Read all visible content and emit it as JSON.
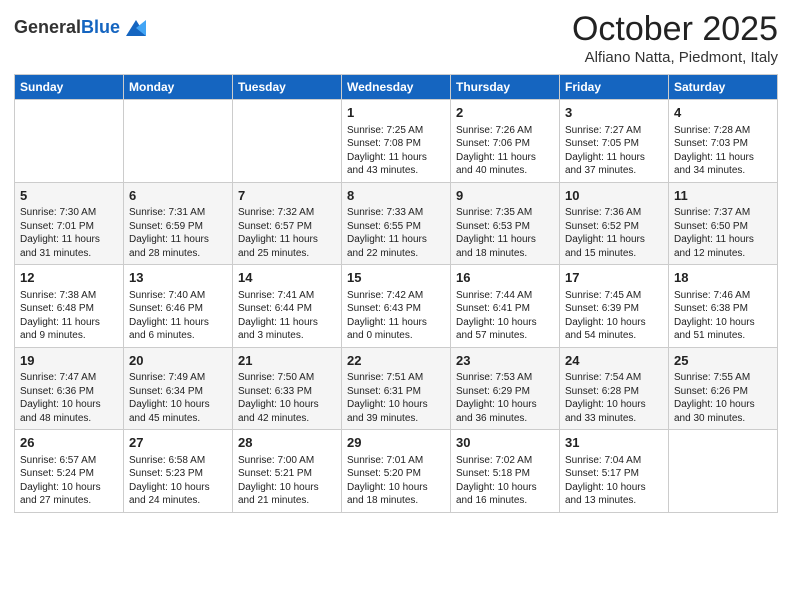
{
  "header": {
    "logo_general": "General",
    "logo_blue": "Blue",
    "month_title": "October 2025",
    "location": "Alfiano Natta, Piedmont, Italy"
  },
  "days_of_week": [
    "Sunday",
    "Monday",
    "Tuesday",
    "Wednesday",
    "Thursday",
    "Friday",
    "Saturday"
  ],
  "weeks": [
    [
      {
        "day": "",
        "content": ""
      },
      {
        "day": "",
        "content": ""
      },
      {
        "day": "",
        "content": ""
      },
      {
        "day": "1",
        "content": "Sunrise: 7:25 AM\nSunset: 7:08 PM\nDaylight: 11 hours\nand 43 minutes."
      },
      {
        "day": "2",
        "content": "Sunrise: 7:26 AM\nSunset: 7:06 PM\nDaylight: 11 hours\nand 40 minutes."
      },
      {
        "day": "3",
        "content": "Sunrise: 7:27 AM\nSunset: 7:05 PM\nDaylight: 11 hours\nand 37 minutes."
      },
      {
        "day": "4",
        "content": "Sunrise: 7:28 AM\nSunset: 7:03 PM\nDaylight: 11 hours\nand 34 minutes."
      }
    ],
    [
      {
        "day": "5",
        "content": "Sunrise: 7:30 AM\nSunset: 7:01 PM\nDaylight: 11 hours\nand 31 minutes."
      },
      {
        "day": "6",
        "content": "Sunrise: 7:31 AM\nSunset: 6:59 PM\nDaylight: 11 hours\nand 28 minutes."
      },
      {
        "day": "7",
        "content": "Sunrise: 7:32 AM\nSunset: 6:57 PM\nDaylight: 11 hours\nand 25 minutes."
      },
      {
        "day": "8",
        "content": "Sunrise: 7:33 AM\nSunset: 6:55 PM\nDaylight: 11 hours\nand 22 minutes."
      },
      {
        "day": "9",
        "content": "Sunrise: 7:35 AM\nSunset: 6:53 PM\nDaylight: 11 hours\nand 18 minutes."
      },
      {
        "day": "10",
        "content": "Sunrise: 7:36 AM\nSunset: 6:52 PM\nDaylight: 11 hours\nand 15 minutes."
      },
      {
        "day": "11",
        "content": "Sunrise: 7:37 AM\nSunset: 6:50 PM\nDaylight: 11 hours\nand 12 minutes."
      }
    ],
    [
      {
        "day": "12",
        "content": "Sunrise: 7:38 AM\nSunset: 6:48 PM\nDaylight: 11 hours\nand 9 minutes."
      },
      {
        "day": "13",
        "content": "Sunrise: 7:40 AM\nSunset: 6:46 PM\nDaylight: 11 hours\nand 6 minutes."
      },
      {
        "day": "14",
        "content": "Sunrise: 7:41 AM\nSunset: 6:44 PM\nDaylight: 11 hours\nand 3 minutes."
      },
      {
        "day": "15",
        "content": "Sunrise: 7:42 AM\nSunset: 6:43 PM\nDaylight: 11 hours\nand 0 minutes."
      },
      {
        "day": "16",
        "content": "Sunrise: 7:44 AM\nSunset: 6:41 PM\nDaylight: 10 hours\nand 57 minutes."
      },
      {
        "day": "17",
        "content": "Sunrise: 7:45 AM\nSunset: 6:39 PM\nDaylight: 10 hours\nand 54 minutes."
      },
      {
        "day": "18",
        "content": "Sunrise: 7:46 AM\nSunset: 6:38 PM\nDaylight: 10 hours\nand 51 minutes."
      }
    ],
    [
      {
        "day": "19",
        "content": "Sunrise: 7:47 AM\nSunset: 6:36 PM\nDaylight: 10 hours\nand 48 minutes."
      },
      {
        "day": "20",
        "content": "Sunrise: 7:49 AM\nSunset: 6:34 PM\nDaylight: 10 hours\nand 45 minutes."
      },
      {
        "day": "21",
        "content": "Sunrise: 7:50 AM\nSunset: 6:33 PM\nDaylight: 10 hours\nand 42 minutes."
      },
      {
        "day": "22",
        "content": "Sunrise: 7:51 AM\nSunset: 6:31 PM\nDaylight: 10 hours\nand 39 minutes."
      },
      {
        "day": "23",
        "content": "Sunrise: 7:53 AM\nSunset: 6:29 PM\nDaylight: 10 hours\nand 36 minutes."
      },
      {
        "day": "24",
        "content": "Sunrise: 7:54 AM\nSunset: 6:28 PM\nDaylight: 10 hours\nand 33 minutes."
      },
      {
        "day": "25",
        "content": "Sunrise: 7:55 AM\nSunset: 6:26 PM\nDaylight: 10 hours\nand 30 minutes."
      }
    ],
    [
      {
        "day": "26",
        "content": "Sunrise: 6:57 AM\nSunset: 5:24 PM\nDaylight: 10 hours\nand 27 minutes."
      },
      {
        "day": "27",
        "content": "Sunrise: 6:58 AM\nSunset: 5:23 PM\nDaylight: 10 hours\nand 24 minutes."
      },
      {
        "day": "28",
        "content": "Sunrise: 7:00 AM\nSunset: 5:21 PM\nDaylight: 10 hours\nand 21 minutes."
      },
      {
        "day": "29",
        "content": "Sunrise: 7:01 AM\nSunset: 5:20 PM\nDaylight: 10 hours\nand 18 minutes."
      },
      {
        "day": "30",
        "content": "Sunrise: 7:02 AM\nSunset: 5:18 PM\nDaylight: 10 hours\nand 16 minutes."
      },
      {
        "day": "31",
        "content": "Sunrise: 7:04 AM\nSunset: 5:17 PM\nDaylight: 10 hours\nand 13 minutes."
      },
      {
        "day": "",
        "content": ""
      }
    ]
  ]
}
